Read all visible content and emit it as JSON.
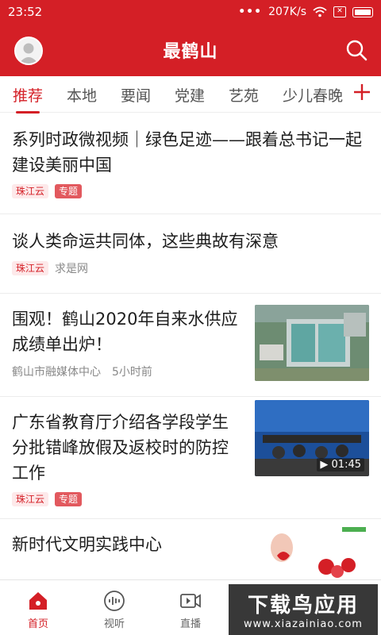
{
  "status_bar": {
    "time": "23:52",
    "network_speed": "207K/s",
    "dots": "•••"
  },
  "header": {
    "title": "最鹤山"
  },
  "tabs": [
    {
      "label": "推荐",
      "active": true
    },
    {
      "label": "本地",
      "active": false
    },
    {
      "label": "要闻",
      "active": false
    },
    {
      "label": "党建",
      "active": false
    },
    {
      "label": "艺苑",
      "active": false
    },
    {
      "label": "少儿春晚",
      "active": false
    }
  ],
  "feed": {
    "items": [
      {
        "title": "系列时政微视频｜绿色足迹——跟着总书记一起建设美丽中国",
        "source_tag": "珠江云",
        "special_tag": "专题"
      },
      {
        "title": "谈人类命运共同体，这些典故有深意",
        "source_tag": "珠江云",
        "publisher": "求是网"
      },
      {
        "title": "围观！鹤山2020年自来水供应成绩单出炉！",
        "publisher": "鹤山市融媒体中心",
        "time_ago": "5小时前"
      },
      {
        "title": "广东省教育厅介绍各学段学生分批错峰放假及返校时的防控工作",
        "source_tag": "珠江云",
        "special_tag": "专题",
        "video_duration": "▶ 01:45"
      },
      {
        "title": "新时代文明实践中心"
      }
    ]
  },
  "bottom_nav": [
    {
      "label": "首页",
      "icon": "home-icon",
      "active": true
    },
    {
      "label": "视听",
      "icon": "audio-icon",
      "active": false
    },
    {
      "label": "直播",
      "icon": "video-icon",
      "active": false
    }
  ],
  "watermark": {
    "main": "下载鸟应用",
    "sub": "www.xiazainiao.com"
  },
  "colors": {
    "brand": "#d41f26",
    "tag_bg": "#fde9ea",
    "special_tag": "#e2595e"
  }
}
